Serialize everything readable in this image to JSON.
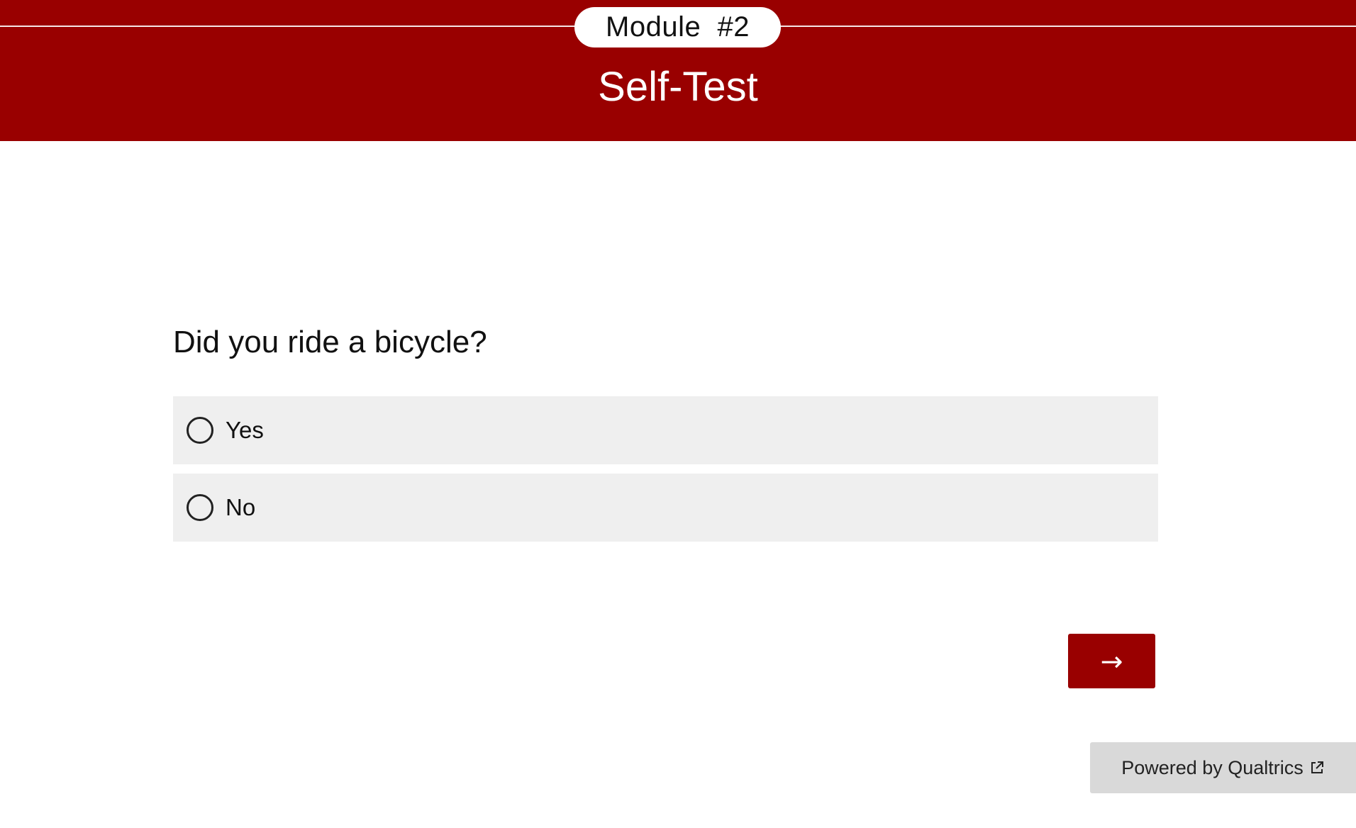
{
  "header": {
    "module_label": "Module  #2",
    "title": "Self-Test"
  },
  "question": {
    "text": "Did you ride a bicycle?",
    "choices": [
      {
        "label": "Yes",
        "selected": false
      },
      {
        "label": "No",
        "selected": false
      }
    ]
  },
  "navigation": {
    "next_label": "→"
  },
  "footer": {
    "powered_by": "Powered by Qualtrics",
    "icon": "external-link-icon"
  },
  "colors": {
    "brand": "#990000",
    "choice_bg": "#efefef",
    "footer_bg": "#d9d9d9"
  }
}
